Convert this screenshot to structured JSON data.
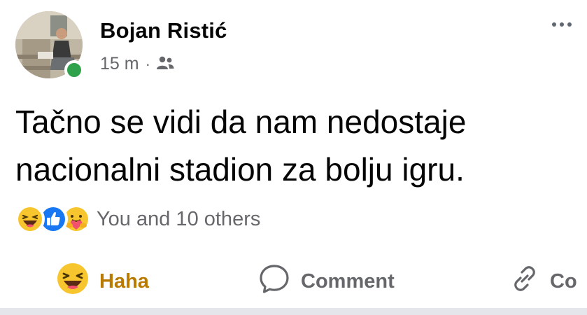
{
  "post": {
    "author": "Bojan Ristić",
    "timestamp": "15 m",
    "separator": "·",
    "audience_icon": "friends-icon",
    "online_status_color": "#31a24c",
    "text": "Tačno se vidi da nam nedostaje\nnacionalni stadion za bolju igru.",
    "reactions": {
      "icons": [
        "haha-reaction-icon",
        "like-reaction-icon",
        "care-reaction-icon"
      ],
      "summary": "You and 10 others"
    },
    "actions": {
      "haha_label": "Haha",
      "comment_label": "Comment",
      "copy_label": "Co"
    },
    "colors": {
      "haha_text": "#b87a00",
      "meta_text": "#65676b",
      "like_blue": "#1877f2"
    }
  }
}
